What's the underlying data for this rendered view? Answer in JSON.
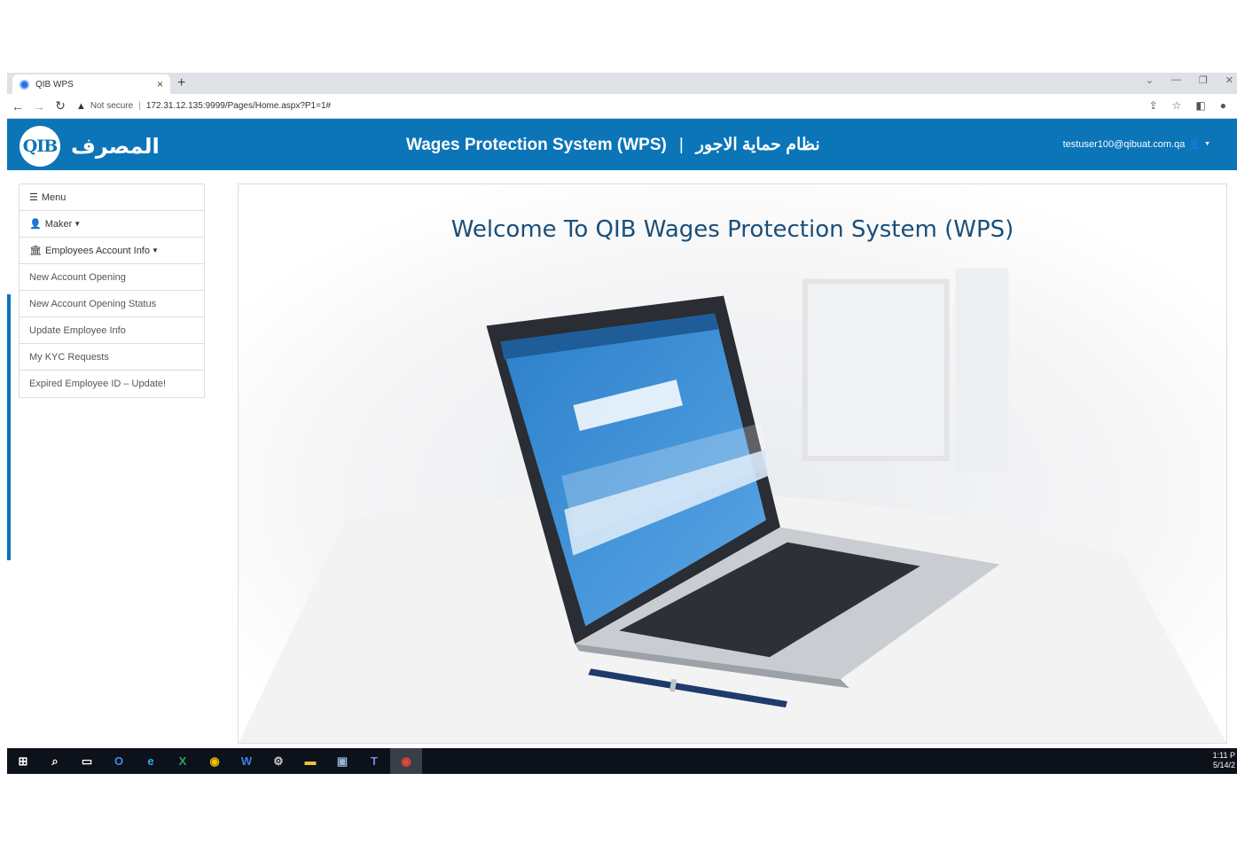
{
  "browser": {
    "tab_title": "QIB WPS",
    "tab_close": "×",
    "new_tab": "+",
    "security_label": "Not secure",
    "url": "172.31.12.135:9999/Pages/Home.aspx?P1=1#"
  },
  "header": {
    "logo_mark": "QIB",
    "logo_arabic": "المصرف",
    "title_en": "Wages Protection System (WPS)",
    "divider": "|",
    "title_ar": "نظام حماية الاجور",
    "user_email": "testuser100@qibuat.com.qa",
    "accent_color": "#0b75b8"
  },
  "sidebar": {
    "menu_label": "Menu",
    "maker_label": "Maker",
    "employees_label": "Employees Account Info",
    "links": [
      "New Account Opening",
      "New Account Opening Status",
      "Update Employee Info",
      "My KYC Requests",
      "Expired Employee ID – Update!"
    ]
  },
  "main": {
    "welcome": "Welcome To QIB Wages Protection System (WPS)"
  },
  "taskbar": {
    "time": "1:11 P",
    "date": "5/14/2"
  }
}
